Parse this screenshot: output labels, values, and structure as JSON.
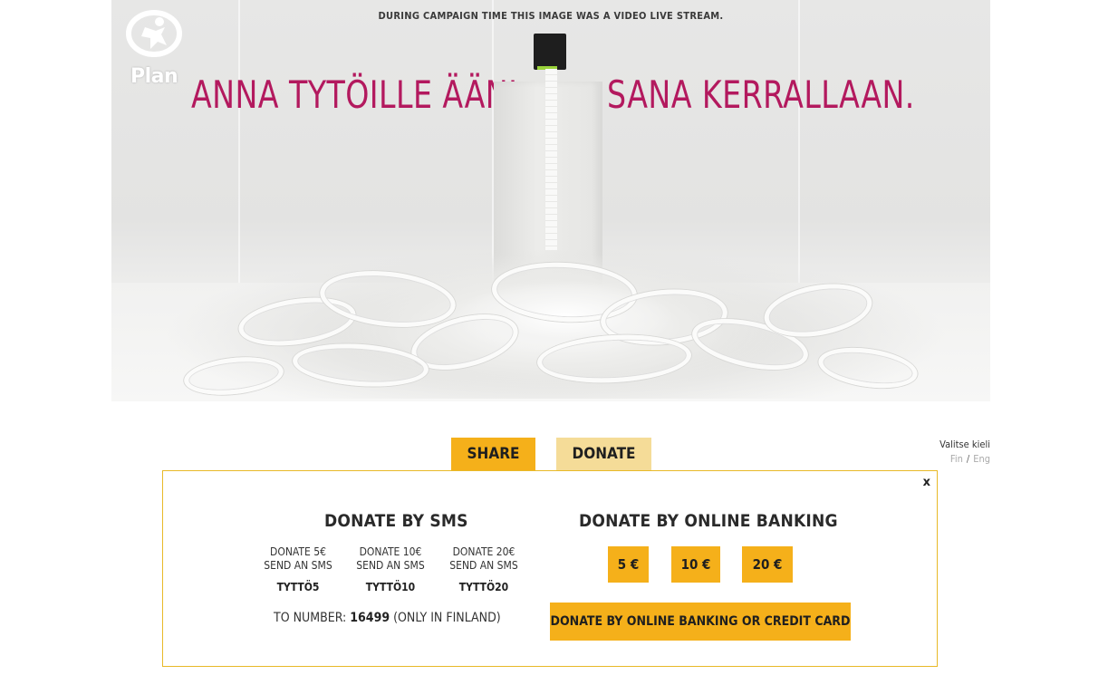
{
  "hero": {
    "stream_note": "DURING CAMPAIGN TIME THIS IMAGE WAS A VIDEO LIVE STREAM.",
    "headline_left": "ANNA TYTÖILLE ÄÄNI",
    "headline_right": "SANA KERRALLAAN.",
    "logo_text": "Plan"
  },
  "tabs": {
    "share": "SHARE",
    "donate": "DONATE"
  },
  "language": {
    "label": "Valitse kieli",
    "fin": "Fin",
    "separator": "/",
    "eng": "Eng"
  },
  "panel": {
    "close": "x",
    "sms": {
      "title": "DONATE BY SMS",
      "options": [
        {
          "amount": "DONATE 5€",
          "instruction": "SEND AN SMS",
          "code": "TYTTÖ5"
        },
        {
          "amount": "DONATE 10€",
          "instruction": "SEND AN SMS",
          "code": "TYTTÖ10"
        },
        {
          "amount": "DONATE 20€",
          "instruction": "SEND AN SMS",
          "code": "TYTTÖ20"
        }
      ],
      "to_number_label": "TO NUMBER:",
      "number": "16499",
      "note": "(ONLY IN FINLAND)"
    },
    "banking": {
      "title": "DONATE BY ONLINE BANKING",
      "amounts": [
        "5 €",
        "10 €",
        "20 €"
      ],
      "card_button": "DONATE BY ONLINE BANKING OR CREDIT CARD"
    }
  },
  "colors": {
    "accent": "#f5b01a",
    "accent_light": "#f5dc98",
    "headline": "#b3195e",
    "panel_border": "#e8b928"
  }
}
